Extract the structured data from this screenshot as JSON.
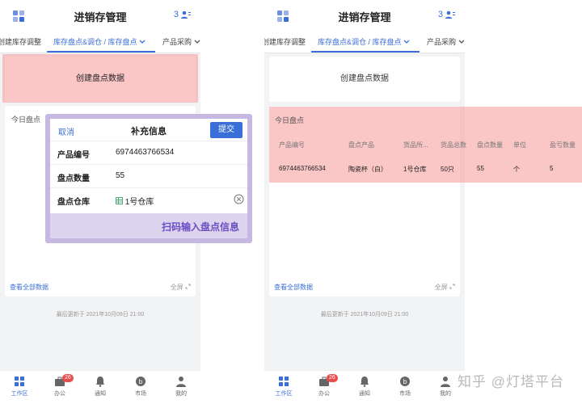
{
  "app": {
    "title": "进销存管理",
    "user_count": "3"
  },
  "tabs": {
    "left_cut": "创建库存调整",
    "active": "库存盘点&调仓 / 库存盘点",
    "right": "产品采购"
  },
  "create_card": {
    "label": "创建盘点数据"
  },
  "today": {
    "title": "今日盘点",
    "view_all": "查看全部数据",
    "fullscreen": "全屏",
    "table": {
      "headers": [
        "产品编号",
        "盘点产品",
        "货品所...",
        "货品总数",
        "盘点数量",
        "单位",
        "盈亏数量"
      ],
      "rows": [
        [
          "6974463766534",
          "陶瓷杯（白）",
          "1号仓库",
          "50只",
          "55",
          "个",
          "5"
        ]
      ]
    }
  },
  "updated": "最后更新于 2021年10月09日 21:00",
  "popup": {
    "cancel": "取消",
    "title": "补充信息",
    "submit": "提交",
    "fields": [
      {
        "label": "产品编号",
        "value": "6974463766534"
      },
      {
        "label": "盘点数量",
        "value": "55"
      },
      {
        "label": "盘点仓库",
        "value": "1号仓库"
      }
    ],
    "scan_hint": "扫码输入盘点信息"
  },
  "tabbar": {
    "items": [
      {
        "label": "工作区",
        "active": true
      },
      {
        "label": "办公",
        "badge": "26"
      },
      {
        "label": "通知"
      },
      {
        "label": "市场"
      },
      {
        "label": "我的"
      }
    ]
  },
  "watermark": "知乎 @灯塔平台",
  "colors": {
    "accent": "#3a6fd8",
    "highlight": "#f7a0a0",
    "popup_frame": "#c7b8e2",
    "scan_text": "#6a4fc3",
    "badge": "#e84c4c"
  }
}
